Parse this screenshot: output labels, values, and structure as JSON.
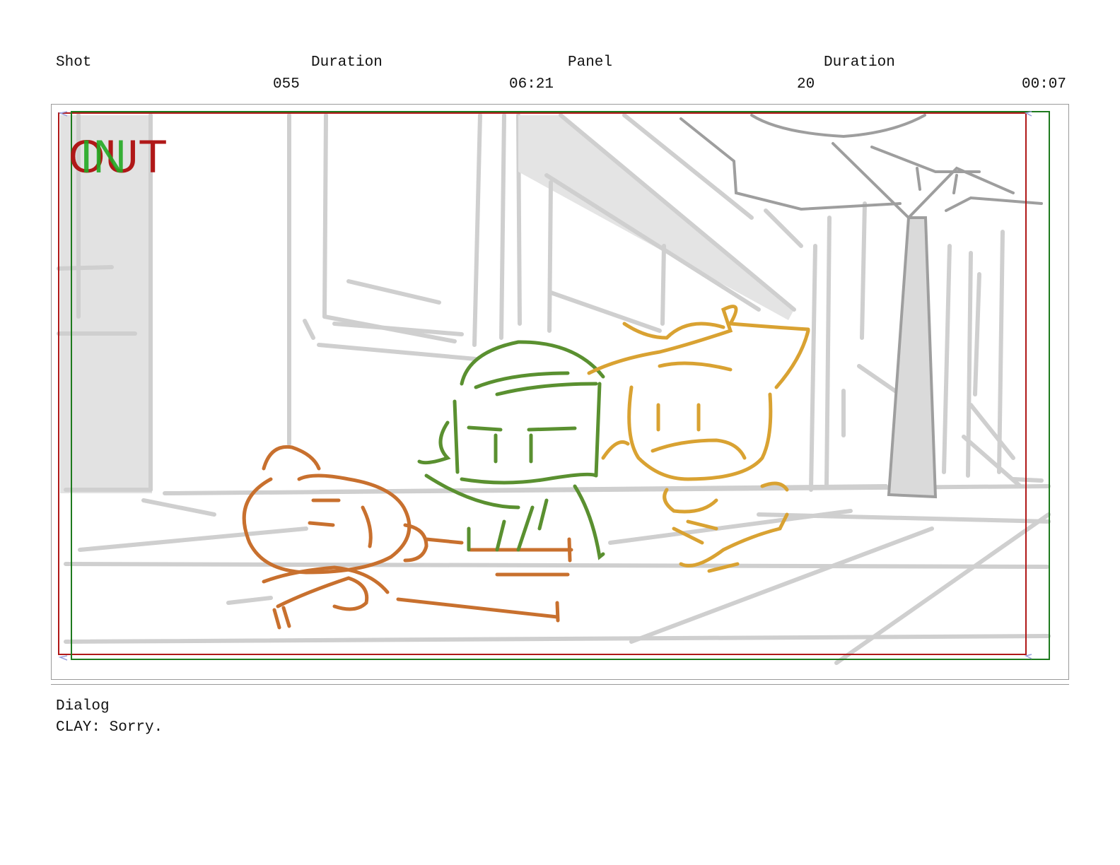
{
  "header": {
    "shot_label": "Shot",
    "shot_duration_label": "Duration",
    "panel_label": "Panel",
    "panel_duration_label": "Duration",
    "shot_value": "055",
    "shot_duration_value": "06:21",
    "panel_value": "20",
    "panel_duration_value": "00:07"
  },
  "panel": {
    "out_marker": "OUT",
    "in_marker": "IN",
    "colors": {
      "safe_frame_red": "#b01818",
      "safe_frame_green": "#1e7a1e",
      "character_orange": "#c8702e",
      "character_green": "#5a9030",
      "character_yellow": "#d9a232",
      "background_gray": "#cfcfcf"
    }
  },
  "dialog": {
    "label": "Dialog",
    "line": "CLAY: Sorry."
  }
}
